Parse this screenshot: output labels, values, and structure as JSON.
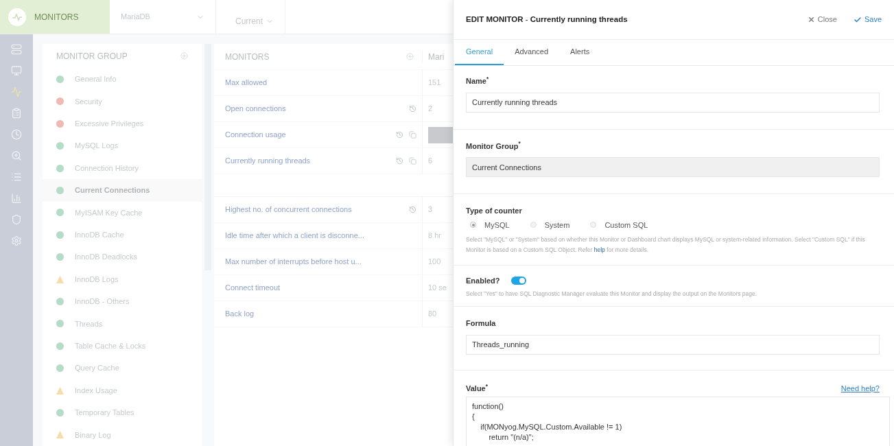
{
  "topbar": {
    "app_title": "MONITORS",
    "server": "MariaDB",
    "timeframe": "Current"
  },
  "sidebar": [
    {
      "selected": false
    },
    {
      "selected": false
    },
    {
      "selected": true
    },
    {
      "selected": false
    },
    {
      "selected": false
    },
    {
      "selected": false
    },
    {
      "selected": false
    },
    {
      "selected": false
    },
    {
      "selected": false
    },
    {
      "selected": false
    }
  ],
  "monitor_group": {
    "title": "MONITOR GROUP",
    "items": [
      {
        "label": "General Info",
        "kind": "dot",
        "color": "#b5dcc6",
        "selected": false
      },
      {
        "label": "Security",
        "kind": "dot",
        "color": "#f0b9b1",
        "selected": false
      },
      {
        "label": "Excessive Privileges",
        "kind": "dot",
        "color": "#f0b9b1",
        "selected": false
      },
      {
        "label": "MySQL Logs",
        "kind": "dot",
        "color": "#b5dcc6",
        "selected": false
      },
      {
        "label": "Connection History",
        "kind": "dot",
        "color": "#b5dcc6",
        "selected": false
      },
      {
        "label": "Current Connections",
        "kind": "dot",
        "color": "#b5dcc6",
        "selected": true
      },
      {
        "label": "MyISAM Key Cache",
        "kind": "dot",
        "color": "#b5dcc6",
        "selected": false
      },
      {
        "label": "InnoDB Cache",
        "kind": "dot",
        "color": "#b5dcc6",
        "selected": false
      },
      {
        "label": "InnoDB Deadlocks",
        "kind": "dot",
        "color": "#b5dcc6",
        "selected": false
      },
      {
        "label": "InnoDB Logs",
        "kind": "triangle",
        "color": "#f5dcaa",
        "selected": false
      },
      {
        "label": "InnoDB - Others",
        "kind": "dot",
        "color": "#b5dcc6",
        "selected": false
      },
      {
        "label": "Threads",
        "kind": "dot",
        "color": "#b5dcc6",
        "selected": false
      },
      {
        "label": "Table Cache & Locks",
        "kind": "dot",
        "color": "#b5dcc6",
        "selected": false
      },
      {
        "label": "Query Cache",
        "kind": "dot",
        "color": "#b5dcc6",
        "selected": false
      },
      {
        "label": "Index Usage",
        "kind": "triangle",
        "color": "#f5dcaa",
        "selected": false
      },
      {
        "label": "Temporary Tables",
        "kind": "dot",
        "color": "#b5dcc6",
        "selected": false
      },
      {
        "label": "Binary Log",
        "kind": "triangle",
        "color": "#f5dcaa",
        "selected": false
      }
    ]
  },
  "monitors": {
    "title": "MONITORS",
    "column_2": "Mari",
    "rows": [
      {
        "kind": "row",
        "name": "Max allowed",
        "value": "151"
      },
      {
        "kind": "row",
        "name": "Open connections",
        "value": "2",
        "history": true
      },
      {
        "kind": "row",
        "name": "Connection usage",
        "value_bar": true,
        "history": true,
        "chart": true
      },
      {
        "kind": "row",
        "name": "Currently running threads",
        "value": "6",
        "history": true,
        "chart": true
      },
      {
        "kind": "spacer"
      },
      {
        "kind": "row",
        "name": "Highest no. of concurrent connections",
        "value": "3",
        "history": true
      },
      {
        "kind": "row",
        "name": "Idle time after which a client is disconne...",
        "value": "8 hr"
      },
      {
        "kind": "row",
        "name": "Max number of interrupts before host u...",
        "value": "100"
      },
      {
        "kind": "row",
        "name": "Connect timeout",
        "value": "10 se"
      },
      {
        "kind": "row",
        "name": "Back log",
        "value": "80"
      }
    ]
  },
  "drawer": {
    "title_prefix": "EDIT MONITOR",
    "title_separator": "-",
    "title": "Currently running threads",
    "close": "Close",
    "save": "Save",
    "tabs": [
      {
        "label": "General",
        "selected": true
      },
      {
        "label": "Advanced",
        "selected": false
      },
      {
        "label": "Alerts",
        "selected": false
      }
    ],
    "name": {
      "label": "Name",
      "required": "*",
      "value": "Currently running threads"
    },
    "group": {
      "label": "Monitor Group",
      "required": "*",
      "value": "Current Connections"
    },
    "counter": {
      "label": "Type of counter",
      "options": [
        {
          "label": "MySQL",
          "selected": true
        },
        {
          "label": "System",
          "selected": false
        },
        {
          "label": "Custom SQL",
          "selected": false
        }
      ],
      "help_before": "Select \"MySQL\" or \"System\" based on whether this Monitor or Dashboard chart displays MySQL or system-related information. Select \"Custom SQL\" if this Monitor is based on a Custom SQL Object. Refer",
      "help_link": "help",
      "help_after": "for more details."
    },
    "enabled": {
      "label": "Enabled?",
      "on": true,
      "help": "Select \"Yes\" to have SQL Diagnostic Manager evaluate this Monitor and display the output on the Monitors page."
    },
    "formula": {
      "label": "Formula",
      "value": "Threads_running"
    },
    "value": {
      "label": "Value",
      "required": "*",
      "help_link": "Need help?",
      "code": [
        "function()",
        "{",
        "    if(MONyog.MySQL.Custom.Available != 1)",
        "        return \"(n/a)\";"
      ]
    }
  }
}
